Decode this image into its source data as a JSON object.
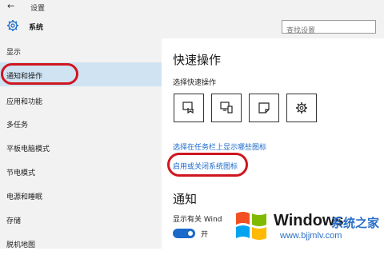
{
  "window": {
    "back_glyph": "←",
    "title": "设置"
  },
  "header": {
    "section": "系统",
    "search_placeholder": "查找设置"
  },
  "sidebar": {
    "items": [
      {
        "label": "显示"
      },
      {
        "label": "通知和操作",
        "active": true
      },
      {
        "label": "应用和功能"
      },
      {
        "label": "多任务"
      },
      {
        "label": "平板电脑模式"
      },
      {
        "label": "节电模式"
      },
      {
        "label": "电源和睡眠"
      },
      {
        "label": "存储"
      },
      {
        "label": "脱机地图"
      }
    ]
  },
  "main": {
    "quick_actions_title": "快速操作",
    "quick_actions_subtitle": "选择快速操作",
    "tiles": [
      "tablet-mode-icon",
      "connect-icon",
      "note-icon",
      "settings-gear-icon"
    ],
    "link_taskbar_icons": "选择在任务栏上显示哪些图标",
    "link_system_icons": "启用或关闭系统图标",
    "notifications_title": "通知",
    "notification_setting_label": "显示有关 Wind",
    "toggle_state": "开"
  },
  "annotations": {
    "highlight_color": "#d0161f"
  },
  "watermark": {
    "brand": "Windows",
    "brand_cn": "系统之家",
    "url": "www.bjjmlv.com"
  },
  "colors": {
    "accent": "#1b6ac9",
    "sidebar_bg": "#f2f2f2",
    "active_bg": "#cfe3f3"
  }
}
